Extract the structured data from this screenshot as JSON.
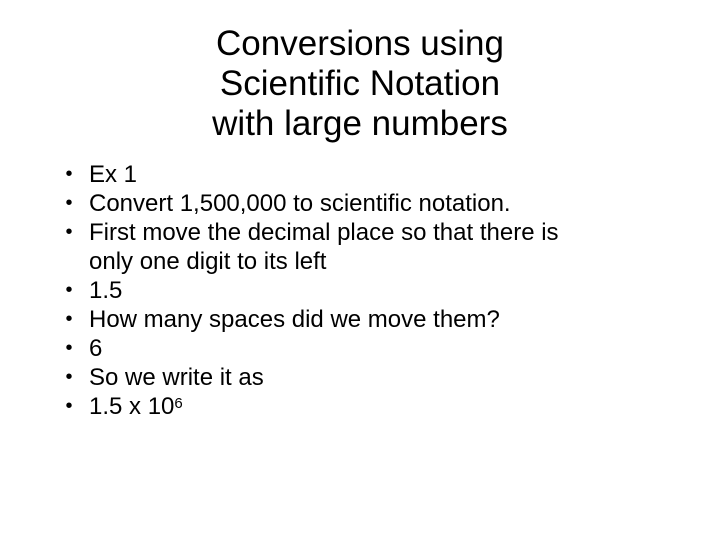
{
  "slide": {
    "title_lines": [
      "Conversions using",
      "Scientific Notation",
      "with large numbers"
    ],
    "bullet_glyph": "•",
    "bullets": [
      {
        "text": "Ex 1"
      },
      {
        "text": "Convert 1,500,000 to scientific notation."
      },
      {
        "text": "First move the decimal place so that there is",
        "text2": "only one digit to its left"
      },
      {
        "text": "1.5"
      },
      {
        "text": "How many spaces did we move them?"
      },
      {
        "text": "6"
      },
      {
        "text": "So we write it as"
      },
      {
        "text": "1.5 x 10",
        "superscript": "6"
      }
    ]
  }
}
